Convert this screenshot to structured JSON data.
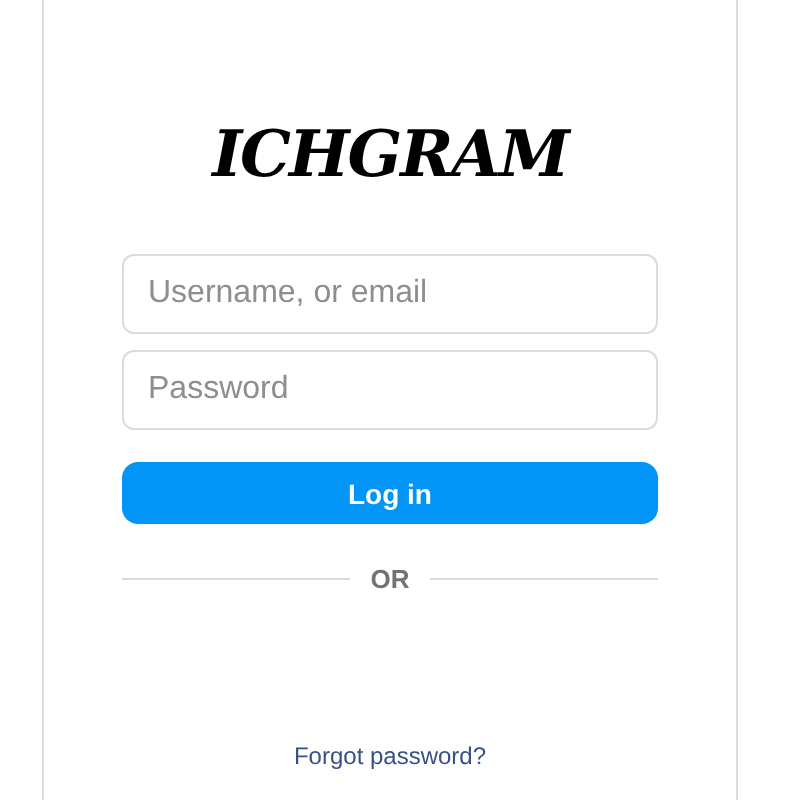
{
  "logo": "ICHGRAM",
  "fields": [
    {
      "placeholder": "Username, or email"
    },
    {
      "placeholder": "Password"
    }
  ],
  "login_button": "Log in",
  "divider": "OR",
  "forgot_link": "Forgot password?"
}
